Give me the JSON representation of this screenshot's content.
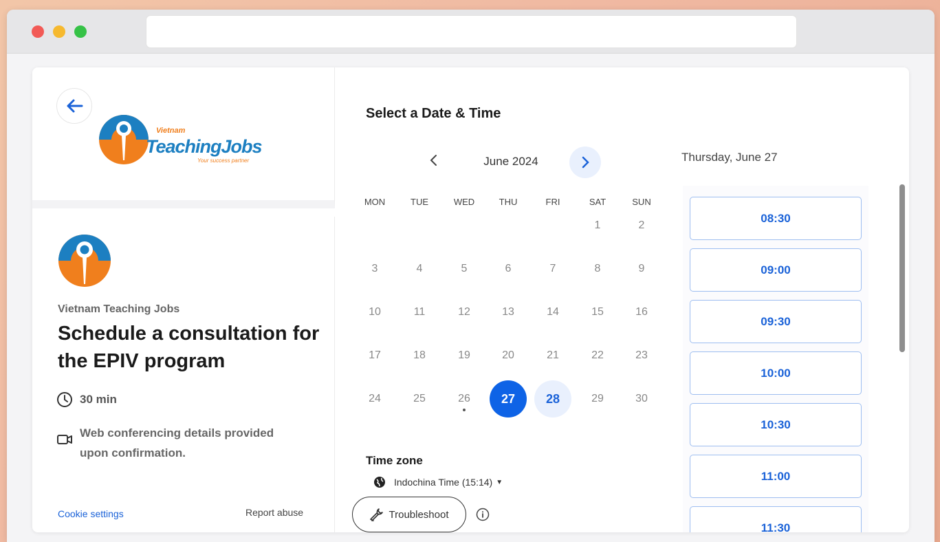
{
  "logo": {
    "small": "Vietnam",
    "big": "TeachingJobs",
    "tagline": "Your success partner"
  },
  "event": {
    "org_name": "Vietnam Teaching Jobs",
    "title": "Schedule a consultation for the EPIV program",
    "duration": "30 min",
    "conferencing": "Web conferencing details provided upon confirmation."
  },
  "footer": {
    "cookie_settings": "Cookie settings",
    "report_abuse": "Report abuse"
  },
  "scheduler": {
    "title": "Select a Date & Time",
    "month": "June 2024",
    "weekdays": [
      "MON",
      "TUE",
      "WED",
      "THU",
      "FRI",
      "SAT",
      "SUN"
    ],
    "weeks": [
      [
        "",
        "",
        "",
        "",
        "",
        "1",
        "2"
      ],
      [
        "3",
        "4",
        "5",
        "6",
        "7",
        "8",
        "9"
      ],
      [
        "10",
        "11",
        "12",
        "13",
        "14",
        "15",
        "16"
      ],
      [
        "17",
        "18",
        "19",
        "20",
        "21",
        "22",
        "23"
      ],
      [
        "24",
        "25",
        "26",
        "27",
        "28",
        "29",
        "30"
      ]
    ],
    "selected_day": "27",
    "available_days": [
      "28"
    ],
    "today_dot_day": "26",
    "timezone_label": "Time zone",
    "timezone_value": "Indochina Time (15:14)",
    "troubleshoot": "Troubleshoot",
    "selected_date_label": "Thursday, June 27",
    "time_slots": [
      "08:30",
      "09:00",
      "09:30",
      "10:00",
      "10:30",
      "11:00",
      "11:30"
    ]
  },
  "colors": {
    "accent": "#0e63e6",
    "accent_light": "#e9f0fd",
    "logo_blue": "#1c7fc1",
    "logo_orange": "#f07f1d"
  }
}
